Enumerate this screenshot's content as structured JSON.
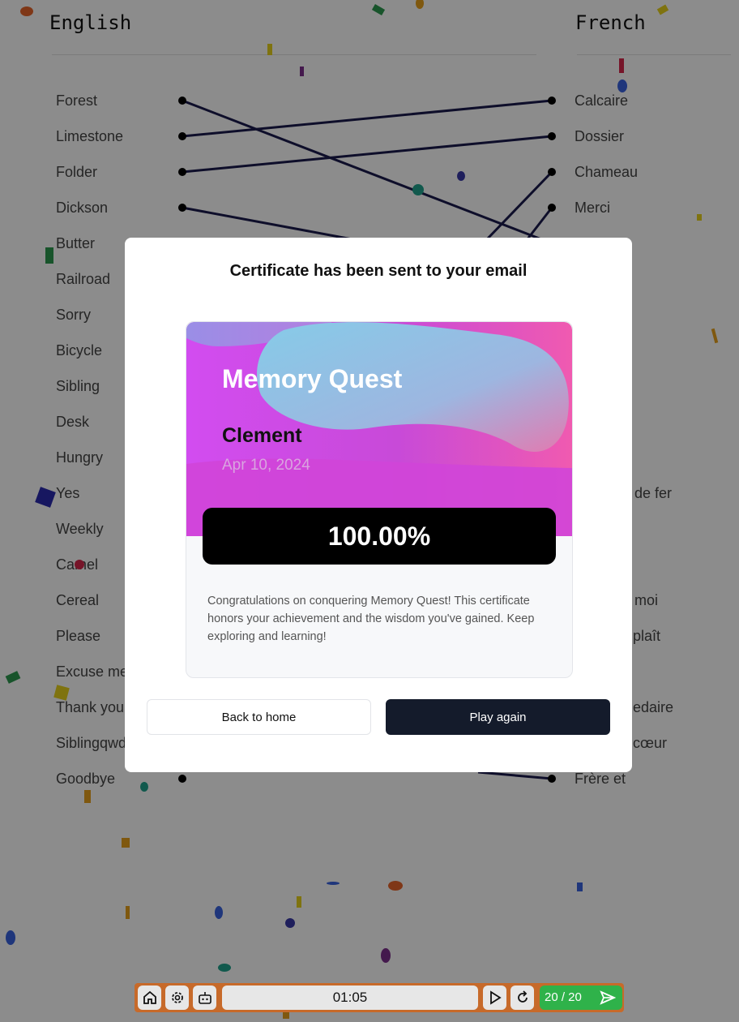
{
  "columns": {
    "left_title": "English",
    "right_title": "French"
  },
  "english_words": [
    "Forest",
    "Limestone",
    "Folder",
    "Dickson",
    "Butter",
    "Railroad",
    "Sorry",
    "Bicycle",
    "Sibling",
    "Desk",
    "Hungry",
    "Yes",
    "Weekly",
    "Camel",
    "Cereal",
    "Please",
    "Excuse me",
    "Thank you",
    "Siblingqwd",
    "Goodbye"
  ],
  "french_words_visible": [
    "Calcaire",
    "Dossier",
    "Chameau",
    "Merci"
  ],
  "french_partial": {
    "row12": "de fer",
    "row15": "moi",
    "row16": "plaît",
    "row18": "edaire",
    "row19": "cœur",
    "row20": "Frère et"
  },
  "modal": {
    "title": "Certificate has been sent to your email",
    "certificate": {
      "quest_name": "Memory Quest",
      "player_name": "Clement",
      "date": "Apr 10, 2024",
      "score": "100.00%",
      "message": "Congratulations on conquering Memory Quest! This certificate honors your achievement and the wisdom you've gained. Keep exploring and learning!"
    },
    "back_label": "Back to home",
    "play_again_label": "Play again"
  },
  "toolbar": {
    "timer": "01:05",
    "progress": "20 / 20"
  },
  "colors": {
    "line": "#1a1a4e",
    "play_button": "#141b2b",
    "toolbar": "#c76a2a",
    "score": "#2fb24a"
  },
  "icons": [
    "home-icon",
    "gear-icon",
    "robot-icon",
    "play-icon",
    "restart-icon",
    "send-icon"
  ]
}
